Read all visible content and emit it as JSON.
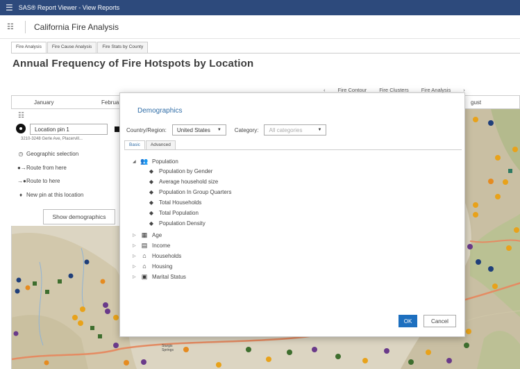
{
  "app": {
    "window_title": "SAS® Report Viewer - View Reports",
    "report_title": "California Fire Analysis"
  },
  "report_tabs": [
    "Fire Analysis",
    "Fire Cause Analysis",
    "Fire Stats by County"
  ],
  "page_heading": "Annual Frequency of Fire Hotspots by Location",
  "link_bar": {
    "prev": "‹",
    "links": [
      "Fire Contour",
      "Fire Clusters",
      "Fire Analysis"
    ],
    "next": "›"
  },
  "months": {
    "january": "January",
    "february": "Februa",
    "august": "gust"
  },
  "location_panel": {
    "pin_name": "Location pin 1",
    "address": "3210-3248 Gerle Ave, Placervill...",
    "actions": [
      "Geographic selection",
      "Route from here",
      "Route to here",
      "New pin at this location"
    ],
    "show_demographics": "Show demographics"
  },
  "map_labels": {
    "town": "Sturgis\nSprings"
  },
  "dialog": {
    "title": "Demographics",
    "country_label": "Country/Region:",
    "country_value": "United States",
    "category_label": "Category:",
    "category_placeholder": "All categories",
    "tabs": [
      "Basic",
      "Advanced"
    ],
    "tree": {
      "population": "Population",
      "population_children": [
        "Population by Gender",
        "Average household size",
        "Population In Group Quarters",
        "Total Households",
        "Total Population",
        "Population Density"
      ],
      "groups": [
        "Age",
        "Income",
        "Households",
        "Housing",
        "Marital Status"
      ]
    },
    "ok": "OK",
    "cancel": "Cancel"
  },
  "colors": {
    "title_bar": "#2d4a7c",
    "accent": "#1d6fbf",
    "dialog_title": "#2e6ca6"
  }
}
